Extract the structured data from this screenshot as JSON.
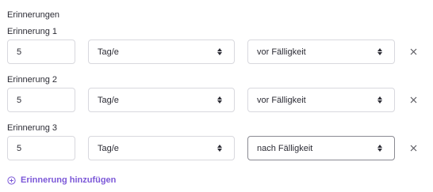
{
  "section": {
    "title": "Erinnerungen"
  },
  "reminders": [
    {
      "label": "Erinnerung 1",
      "amount": "5",
      "unit": "Tag/e",
      "relation": "vor Fälligkeit"
    },
    {
      "label": "Erinnerung 2",
      "amount": "5",
      "unit": "Tag/e",
      "relation": "vor Fälligkeit"
    },
    {
      "label": "Erinnerung 3",
      "amount": "5",
      "unit": "Tag/e",
      "relation": "nach Fälligkeit"
    }
  ],
  "icons": {
    "select": "chevron-updown-icon",
    "remove": "close-icon",
    "add": "plus-circle-icon"
  },
  "add_link": {
    "label": "Erinnerung hinzufügen"
  },
  "colors": {
    "accent": "#7c58d8",
    "text": "#2c2c35",
    "border": "#d8d8de"
  }
}
